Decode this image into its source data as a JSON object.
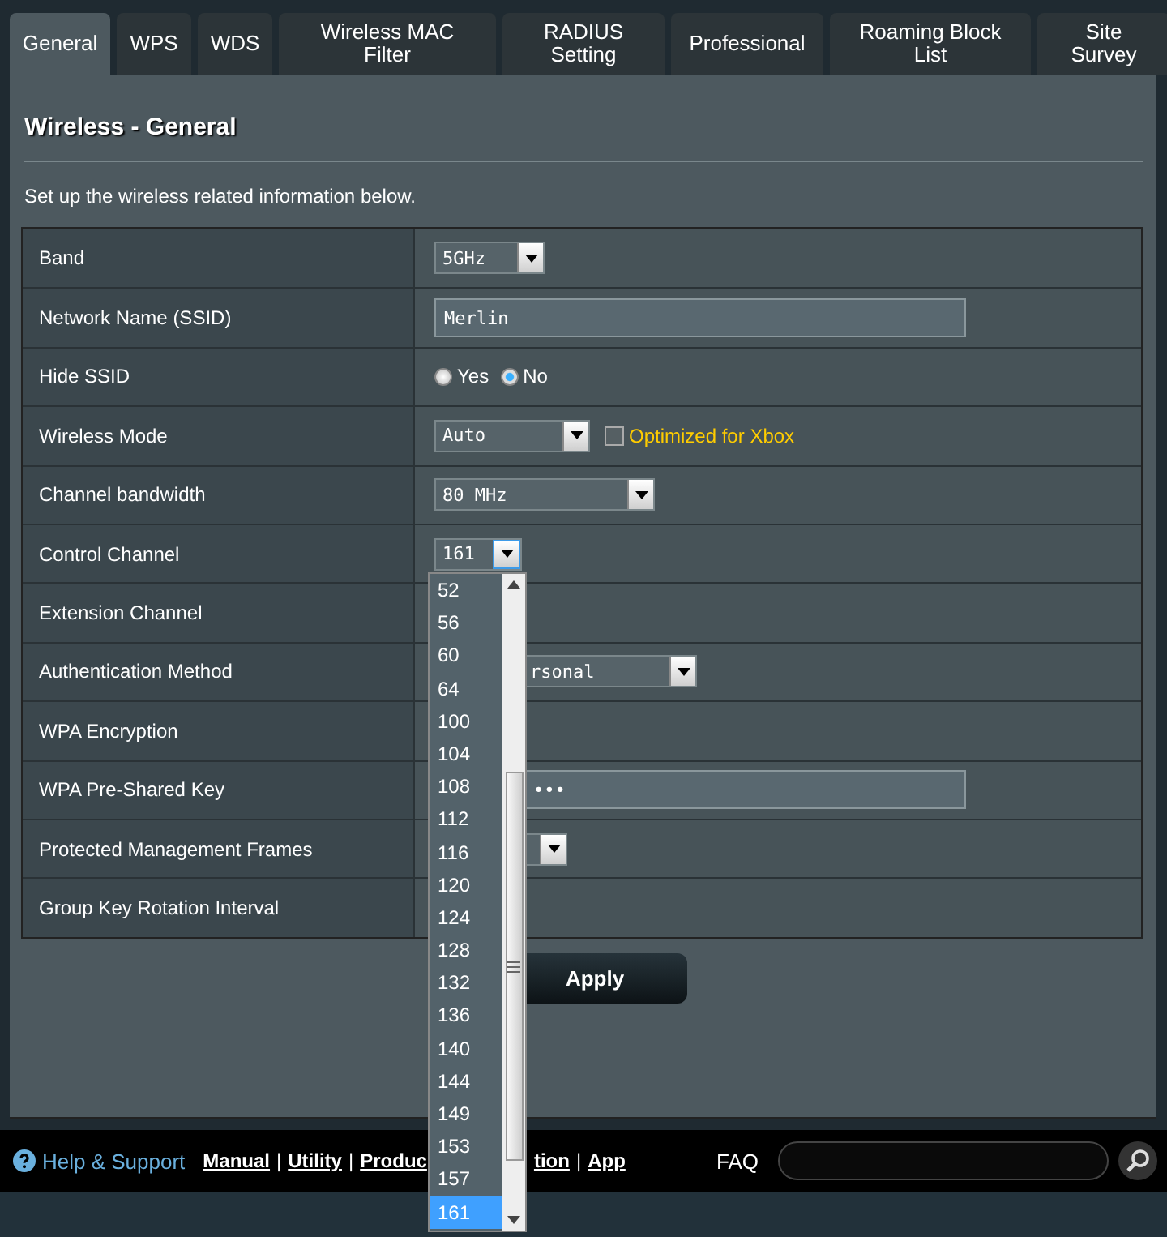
{
  "tabs": [
    {
      "label": "General",
      "selected": true
    },
    {
      "label": "WPS",
      "selected": false
    },
    {
      "label": "WDS",
      "selected": false
    },
    {
      "label": "Wireless MAC Filter",
      "selected": false
    },
    {
      "label": "RADIUS Setting",
      "selected": false
    },
    {
      "label": "Professional",
      "selected": false
    },
    {
      "label": "Roaming Block List",
      "selected": false
    },
    {
      "label": "Site Survey",
      "selected": false
    }
  ],
  "title": "Wireless - General",
  "description": "Set up the wireless related information below.",
  "rows": [
    {
      "label": "Band",
      "kind": "select",
      "value": "5GHz"
    },
    {
      "label": "Network Name (SSID)",
      "kind": "text",
      "value": "Merlin"
    },
    {
      "label": "Hide SSID",
      "kind": "radio",
      "options": [
        {
          "label": "Yes",
          "selected": false
        },
        {
          "label": "No",
          "selected": true
        }
      ]
    },
    {
      "label": "Wireless Mode",
      "kind": "select",
      "value": "Auto",
      "checkbox": {
        "label": "Optimized for Xbox",
        "checked": false
      }
    },
    {
      "label": "Channel bandwidth",
      "kind": "select",
      "value": "80 MHz"
    },
    {
      "label": "Control Channel",
      "kind": "select",
      "value": "161",
      "open": true
    },
    {
      "label": "Extension Channel",
      "kind": "hidden"
    },
    {
      "label": "Authentication Method",
      "kind": "select",
      "value": "rsonal",
      "covered": true
    },
    {
      "label": "WPA Encryption",
      "kind": "hidden"
    },
    {
      "label": "WPA Pre-Shared Key",
      "kind": "password",
      "value": "•••",
      "covered": true
    },
    {
      "label": "Protected Management Frames",
      "kind": "select",
      "covered": true
    },
    {
      "label": "Group Key Rotation Interval",
      "kind": "hidden"
    }
  ],
  "dropdown": [
    {
      "label": "52",
      "selected": false
    },
    {
      "label": "56",
      "selected": false
    },
    {
      "label": "60",
      "selected": false
    },
    {
      "label": "64",
      "selected": false
    },
    {
      "label": "100",
      "selected": false
    },
    {
      "label": "104",
      "selected": false
    },
    {
      "label": "108",
      "selected": false
    },
    {
      "label": "112",
      "selected": false
    },
    {
      "label": "116",
      "selected": false
    },
    {
      "label": "120",
      "selected": false
    },
    {
      "label": "124",
      "selected": false
    },
    {
      "label": "128",
      "selected": false
    },
    {
      "label": "132",
      "selected": false
    },
    {
      "label": "136",
      "selected": false
    },
    {
      "label": "140",
      "selected": false
    },
    {
      "label": "144",
      "selected": false
    },
    {
      "label": "149",
      "selected": false
    },
    {
      "label": "153",
      "selected": false
    },
    {
      "label": "157",
      "selected": false
    },
    {
      "label": "161",
      "selected": true
    }
  ],
  "apply": "Apply",
  "footer": {
    "help": "Help & Support",
    "links": [
      {
        "kind": "link",
        "text": "Manual"
      },
      {
        "kind": "sep",
        "text": "|"
      },
      {
        "kind": "link",
        "text": "Utility"
      },
      {
        "kind": "sep",
        "text": "|"
      },
      {
        "kind": "link",
        "text": "Produc"
      },
      {
        "kind": "link",
        "text": "tion",
        "covered": true
      },
      {
        "kind": "sep",
        "text": "|"
      },
      {
        "kind": "link",
        "text": "App"
      }
    ],
    "faq": "FAQ"
  }
}
